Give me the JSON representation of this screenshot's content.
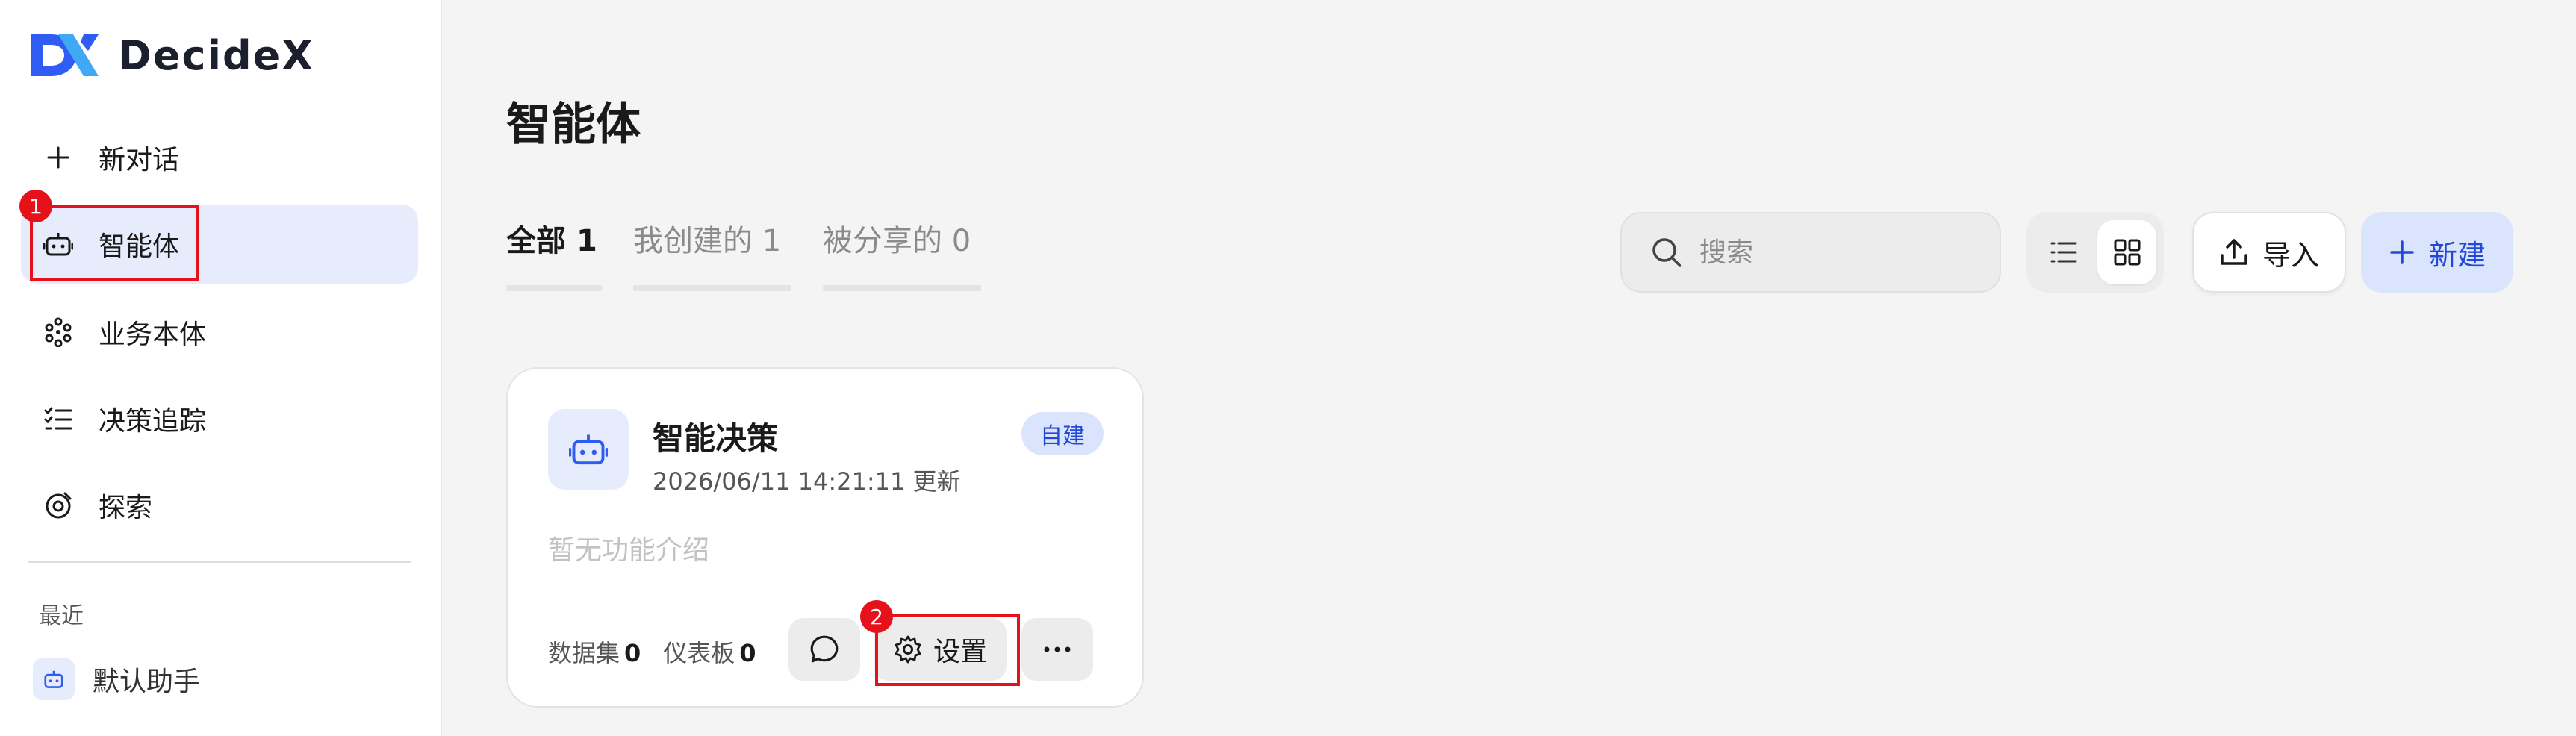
{
  "app": {
    "name": "DecideX",
    "brand_color": "#2f5cf2",
    "accent_light": "#e7ecfc",
    "annotation_color": "#e5121b"
  },
  "sidebar": {
    "items": [
      {
        "label": "新对话",
        "icon": "plus-icon"
      },
      {
        "label": "智能体",
        "icon": "robot-icon",
        "active": true
      },
      {
        "label": "业务本体",
        "icon": "hexagon-nodes-icon"
      },
      {
        "label": "决策追踪",
        "icon": "checklist-icon"
      },
      {
        "label": "探索",
        "icon": "explore-icon"
      }
    ],
    "recent_title": "最近",
    "recent_items": [
      {
        "label": "默认助手",
        "icon": "robot-icon"
      }
    ]
  },
  "annotations": [
    "1",
    "2"
  ],
  "main": {
    "title": "智能体",
    "tabs": [
      {
        "label": "全部",
        "count": "1",
        "active": true
      },
      {
        "label": "我创建的",
        "count": "1"
      },
      {
        "label": "被分享的",
        "count": "0"
      }
    ],
    "search": {
      "placeholder": "搜索"
    },
    "import_label": "导入",
    "new_label": "新建",
    "view_mode": "grid"
  },
  "cards": [
    {
      "name": "智能决策",
      "updated": "2026/06/11 14:21:11 更新",
      "badge": "自建",
      "description": "暂无功能介绍",
      "datasets_label": "数据集",
      "datasets_count": "0",
      "dashboards_label": "仪表板",
      "dashboards_count": "0",
      "settings_label": "设置"
    }
  ]
}
